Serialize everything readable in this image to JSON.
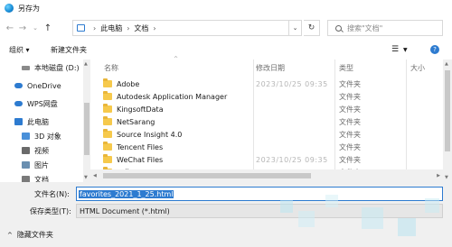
{
  "window": {
    "title": "另存为"
  },
  "address": {
    "crumbs": [
      "此电脑",
      "文档"
    ]
  },
  "search": {
    "placeholder": "搜索\"文档\""
  },
  "toolbar": {
    "organize": "组织 ▾",
    "new_folder": "新建文件夹"
  },
  "nav": {
    "items": [
      {
        "label": "本地磁盘 (D:)",
        "color": "#8a8a8a"
      },
      {
        "label": "OneDrive",
        "color": "#2d7bd0"
      },
      {
        "label": "WPS网盘",
        "color": "#2d7bd0"
      },
      {
        "label": "此电脑",
        "color": "#2d7bd0"
      },
      {
        "label": "3D 对象",
        "color": "#4a90d9"
      },
      {
        "label": "视频",
        "color": "#6a6a6a"
      },
      {
        "label": "图片",
        "color": "#6a8fb0"
      },
      {
        "label": "文档",
        "color": "#7a7a7a"
      }
    ]
  },
  "columns": {
    "name": "名称",
    "date": "修改日期",
    "type": "类型",
    "size": "大小"
  },
  "files": [
    {
      "name": "Adobe",
      "date": "2023/10/25 09:35",
      "type": "文件夹"
    },
    {
      "name": "Autodesk Application Manager",
      "date": "",
      "type": "文件夹"
    },
    {
      "name": "KingsoftData",
      "date": "",
      "type": "文件夹"
    },
    {
      "name": "NetSarang",
      "date": "",
      "type": "文件夹"
    },
    {
      "name": "Source Insight 4.0",
      "date": "",
      "type": "文件夹"
    },
    {
      "name": "Tencent Files",
      "date": "",
      "type": "文件夹"
    },
    {
      "name": "WeChat Files",
      "date": "2023/10/25 09:35",
      "type": "文件夹"
    },
    {
      "name": "工作",
      "date": "",
      "type": "文件夹"
    }
  ],
  "form": {
    "filename_label": "文件名(N):",
    "filename_value": "favorites_2021_1_25.html",
    "filetype_label": "保存类型(T):",
    "filetype_value": "HTML Document (*.html)",
    "hide_folders": "隐藏文件夹"
  }
}
